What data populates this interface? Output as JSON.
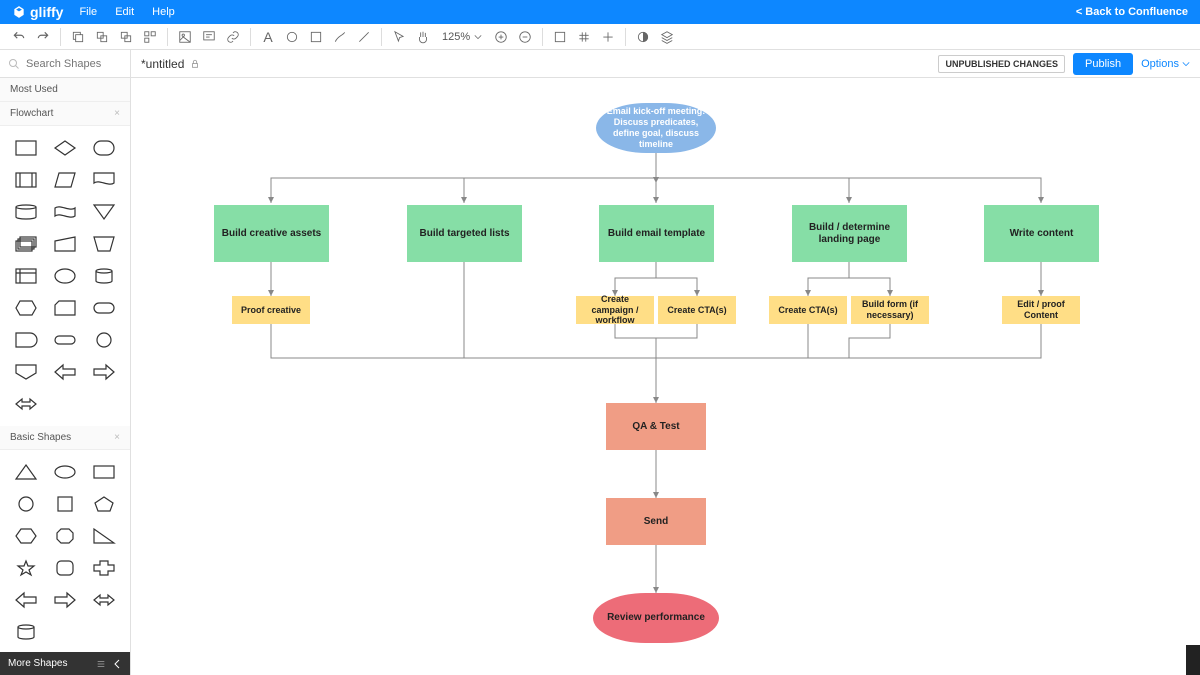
{
  "header": {
    "logo": "gliffy",
    "menu": [
      "File",
      "Edit",
      "Help"
    ],
    "back_link": "< Back to Confluence"
  },
  "toolbar": {
    "zoom": "125%"
  },
  "titlebar": {
    "search_placeholder": "Search Shapes",
    "doc_title": "*untitled",
    "unpublished": "UNPUBLISHED CHANGES",
    "publish": "Publish",
    "options": "Options"
  },
  "sidebar": {
    "most_used": "Most Used",
    "flowchart": "Flowchart",
    "basic_shapes": "Basic Shapes",
    "more_shapes": "More Shapes"
  },
  "diagram": {
    "start": "Email kick-off meeting: Discuss predicates, define goal, discuss timeline",
    "row2": {
      "build_creative": "Build creative assets",
      "build_lists": "Build targeted lists",
      "build_template": "Build email template",
      "build_landing": "Build / determine landing page",
      "write_content": "Write content"
    },
    "row3": {
      "proof_creative": "Proof creative",
      "create_campaign": "Create campaign / workflow",
      "create_cta1": "Create CTA(s)",
      "create_cta2": "Create CTA(s)",
      "build_form": "Build form (if necessary)",
      "edit_content": "Edit / proof Content"
    },
    "qa_test": "QA & Test",
    "send": "Send",
    "review": "Review performance"
  }
}
